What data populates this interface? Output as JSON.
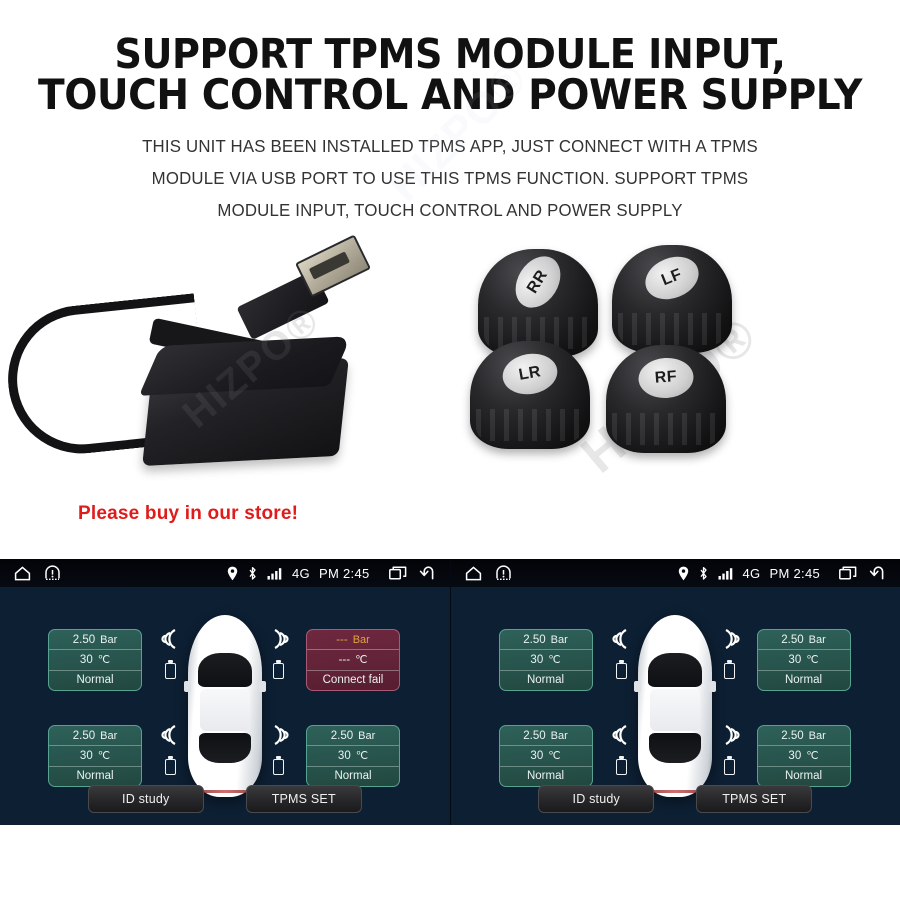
{
  "headline": {
    "line1": "SUPPORT TPMS MODULE INPUT,",
    "line2": "TOUCH CONTROL AND POWER SUPPLY"
  },
  "description": {
    "line1": "THIS UNIT HAS BEEN INSTALLED TPMS APP, JUST CONNECT WITH A TPMS",
    "line2": "MODULE VIA USB PORT TO USE THIS TPMS FUNCTION.  SUPPORT TPMS",
    "line3": "MODULE INPUT, TOUCH CONTROL AND POWER SUPPLY"
  },
  "store_note": "Please buy in our store!",
  "watermark": "HIZPO®",
  "sensors": [
    {
      "label": "RR"
    },
    {
      "label": "LF"
    },
    {
      "label": "LR"
    },
    {
      "label": "RF"
    }
  ],
  "colors": {
    "screen_bg": "#143150",
    "box_ok": "#27544d",
    "box_ok_border": "#58a292",
    "box_fail": "#632338",
    "box_fail_border": "#a85a74",
    "fail_accent": "#e2a23a",
    "store_note": "#e01b1b",
    "status_bar": "#05080e"
  },
  "statusbar": {
    "home_icon": "home-icon",
    "tpms_warning_icon": "tpms-warning-icon",
    "location_icon": "location-pin-icon",
    "bluetooth_icon": "bluetooth-icon",
    "signal_icon": "signal-bars-icon",
    "network": "4G",
    "clock": "PM 2:45",
    "recents_icon": "recent-apps-icon",
    "back_icon": "back-arrow-icon"
  },
  "units": [
    {
      "name": "left-unit",
      "tires": [
        {
          "position": "front-left",
          "pressure": "2.50",
          "pressure_unit": "Bar",
          "temperature": "30",
          "temperature_unit": "℃",
          "status": "Normal",
          "state": "ok"
        },
        {
          "position": "front-right",
          "pressure": "---",
          "pressure_unit": "Bar",
          "temperature": "---",
          "temperature_unit": "℃",
          "status": "Connect fail",
          "state": "fail"
        },
        {
          "position": "rear-left",
          "pressure": "2.50",
          "pressure_unit": "Bar",
          "temperature": "30",
          "temperature_unit": "℃",
          "status": "Normal",
          "state": "ok"
        },
        {
          "position": "rear-right",
          "pressure": "2.50",
          "pressure_unit": "Bar",
          "temperature": "30",
          "temperature_unit": "℃",
          "status": "Normal",
          "state": "ok"
        }
      ],
      "buttons": {
        "id_study": "ID study",
        "tpms_set": "TPMS SET"
      }
    },
    {
      "name": "right-unit",
      "tires": [
        {
          "position": "front-left",
          "pressure": "2.50",
          "pressure_unit": "Bar",
          "temperature": "30",
          "temperature_unit": "℃",
          "status": "Normal",
          "state": "ok"
        },
        {
          "position": "front-right",
          "pressure": "2.50",
          "pressure_unit": "Bar",
          "temperature": "30",
          "temperature_unit": "℃",
          "status": "Normal",
          "state": "ok"
        },
        {
          "position": "rear-left",
          "pressure": "2.50",
          "pressure_unit": "Bar",
          "temperature": "30",
          "temperature_unit": "℃",
          "status": "Normal",
          "state": "ok"
        },
        {
          "position": "rear-right",
          "pressure": "2.50",
          "pressure_unit": "Bar",
          "temperature": "30",
          "temperature_unit": "℃",
          "status": "Normal",
          "state": "ok"
        }
      ],
      "buttons": {
        "id_study": "ID study",
        "tpms_set": "TPMS SET"
      }
    }
  ]
}
